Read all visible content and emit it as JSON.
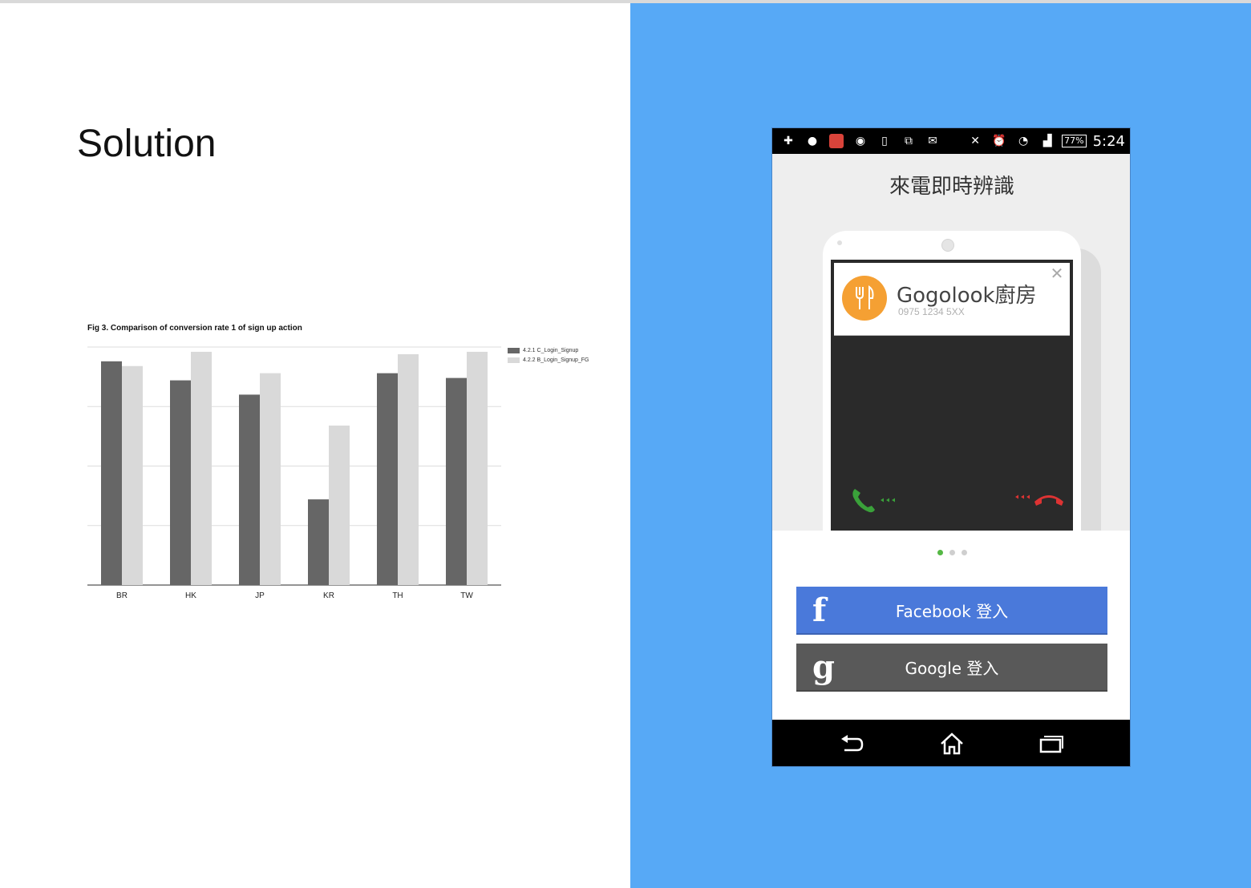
{
  "slide": {
    "title": "Solution"
  },
  "chart_data": {
    "type": "bar",
    "title": "Fig 3. Comparison of conversion rate 1 of sign up action",
    "categories": [
      "BR",
      "HK",
      "JP",
      "KR",
      "TH",
      "TW"
    ],
    "series": [
      {
        "name": "4.2.1 C_Login_Signup",
        "color": "#666666",
        "values": [
          0.94,
          0.86,
          0.8,
          0.36,
          0.89,
          0.87
        ]
      },
      {
        "name": "4.2.2 B_Login_Signup_FG",
        "color": "#d9d9d9",
        "values": [
          0.92,
          0.98,
          0.89,
          0.67,
          0.97,
          0.98
        ]
      }
    ],
    "ylim": [
      0,
      1
    ],
    "gridlines": 4,
    "grid": true,
    "legend_position": "top-right",
    "xlabel": "",
    "ylabel": ""
  },
  "phone": {
    "status_bar": {
      "battery": "77%",
      "time": "5:24"
    },
    "onboarding": {
      "title": "來電即時辨識",
      "caller_name": "Gogolook廚房",
      "caller_number": "0975 1234 5XX",
      "page_count": 3,
      "active_page": 1
    },
    "buttons": {
      "facebook_icon": "f",
      "facebook_label": "Facebook 登入",
      "google_icon": "g",
      "google_label": "Google 登入"
    },
    "colors": {
      "facebook": "#4a79da",
      "google": "#595959",
      "background": "#57a9f6",
      "caller_logo": "#f5a033",
      "active_dot": "#55b845"
    },
    "icons": [
      "back-icon",
      "home-icon",
      "recent-apps-icon"
    ]
  }
}
